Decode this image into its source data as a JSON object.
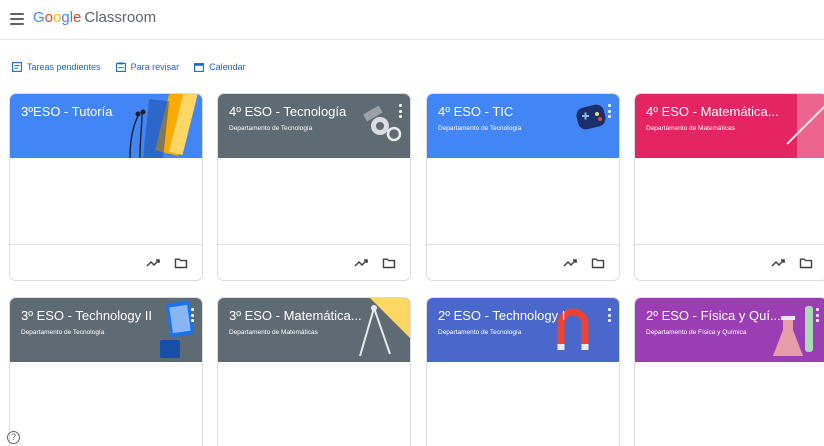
{
  "app": {
    "brand_google": [
      "G",
      "o",
      "o",
      "g",
      "l",
      "e"
    ],
    "brand_product": "Classroom"
  },
  "nav": {
    "items": [
      {
        "label": "Tareas pendientes",
        "icon": "assignment-icon"
      },
      {
        "label": "Para revisar",
        "icon": "review-icon"
      },
      {
        "label": "Calendar",
        "icon": "calendar-icon"
      }
    ]
  },
  "courses": [
    {
      "title": "3ºESO - Tutoría",
      "subtitle": "",
      "color": "#4285f4"
    },
    {
      "title": "4º ESO - Tecnología",
      "subtitle": "Departamento de Tecnología",
      "color": "#5f6b73"
    },
    {
      "title": "4º ESO - TIC",
      "subtitle": "Departamento de Tecnología",
      "color": "#4285f4"
    },
    {
      "title": "4º ESO - Matemática...",
      "subtitle": "Departamento de Matemáticas",
      "color": "#e52563"
    },
    {
      "title": "3º ESO - Technology II",
      "subtitle": "Departamento de Tecnología",
      "color": "#5f6b73"
    },
    {
      "title": "3º ESO - Matemática...",
      "subtitle": "Departamento de Matemáticas",
      "color": "#5f6b73"
    },
    {
      "title": "2º ESO - Technology I",
      "subtitle": "Departamento de Tecnología",
      "color": "#4a68cc"
    },
    {
      "title": "2º ESO - Física y Quí...",
      "subtitle": "Departamento de Física y Química",
      "color": "#9c3eb3"
    }
  ],
  "icons": {
    "menu": "hamburger-menu-icon",
    "card_actions": [
      "trending-icon",
      "folder-icon"
    ],
    "help": "help-icon"
  },
  "help_glyph": "?"
}
